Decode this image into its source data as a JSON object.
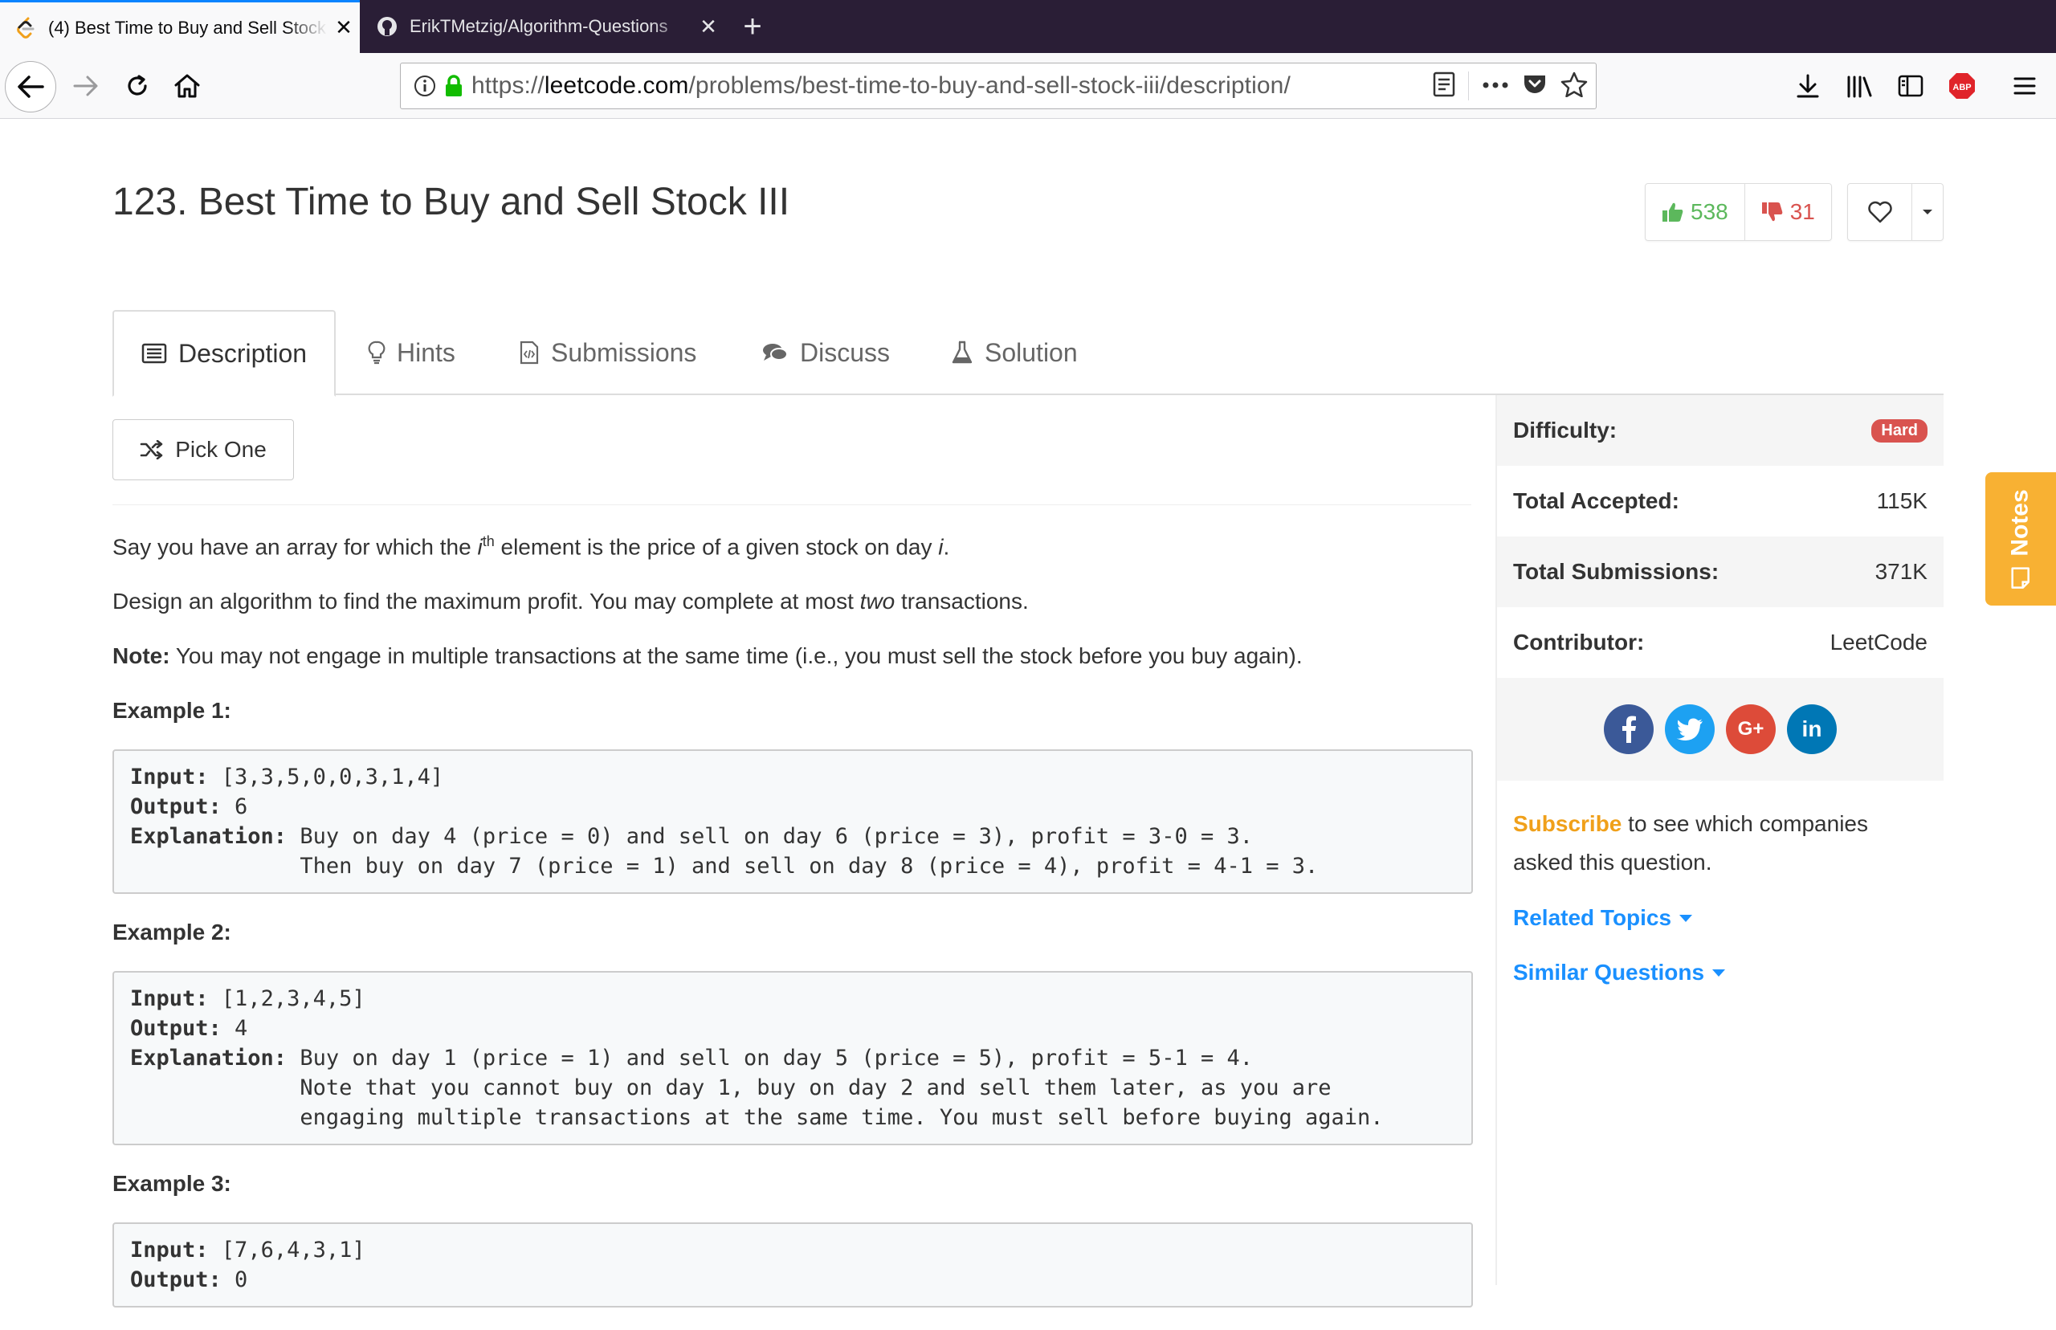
{
  "browser": {
    "tabs": [
      {
        "title": "(4) Best Time to Buy and Sell Stock",
        "active": true
      },
      {
        "title": "ErikTMetzig/Algorithm-Questions",
        "active": false
      }
    ],
    "url_scheme": "https://",
    "url_host": "leetcode.com",
    "url_path": "/problems/best-time-to-buy-and-sell-stock-iii/description/",
    "accent": "#0a84ff"
  },
  "problem": {
    "title": "123. Best Time to Buy and Sell Stock III",
    "likes": "538",
    "dislikes": "31"
  },
  "tabs": [
    "Description",
    "Hints",
    "Submissions",
    "Discuss",
    "Solution"
  ],
  "pick_one": "Pick One",
  "description": {
    "p1_a": "Say you have an array for which the ",
    "p1_i": "i",
    "p1_sup": "th",
    "p1_b": " element is the price of a given stock on day ",
    "p1_day": "i",
    "p1_end": ".",
    "p2_a": "Design an algorithm to find the maximum profit. You may complete at most ",
    "p2_em": "two",
    "p2_b": " transactions.",
    "note_label": "Note:",
    "note_text": " You may not engage in multiple transactions at the same time (i.e., you must sell the stock before you buy again).",
    "examples": [
      {
        "heading": "Example 1:",
        "input_label": "Input:",
        "input": " [3,3,5,0,0,3,1,4]",
        "output_label": "Output:",
        "output": " 6",
        "expl_label": "Explanation:",
        "expl_lines": [
          " Buy on day 4 (price = 0) and sell on day 6 (price = 3), profit = 3-0 = 3.",
          "             Then buy on day 7 (price = 1) and sell on day 8 (price = 4), profit = 4-1 = 3."
        ]
      },
      {
        "heading": "Example 2:",
        "input_label": "Input:",
        "input": " [1,2,3,4,5]",
        "output_label": "Output:",
        "output": " 4",
        "expl_label": "Explanation:",
        "expl_lines": [
          " Buy on day 1 (price = 1) and sell on day 5 (price = 5), profit = 5-1 = 4.",
          "             Note that you cannot buy on day 1, buy on day 2 and sell them later, as you are",
          "             engaging multiple transactions at the same time. You must sell before buying again."
        ]
      },
      {
        "heading": "Example 3:",
        "input_label": "Input:",
        "input": " [7,6,4,3,1]",
        "output_label": "Output:",
        "output": " 0"
      }
    ]
  },
  "sidebar": {
    "difficulty_label": "Difficulty:",
    "difficulty": "Hard",
    "accepted_label": "Total Accepted:",
    "accepted": "115K",
    "submissions_label": "Total Submissions:",
    "submissions": "371K",
    "contributor_label": "Contributor:",
    "contributor": "LeetCode",
    "social": [
      "f",
      "t",
      "G+",
      "in"
    ],
    "subscribe_link": "Subscribe",
    "subscribe_text": " to see which companies asked this question.",
    "related_topics": "Related Topics",
    "similar_questions": "Similar Questions"
  },
  "notes_label": "Notes",
  "colors": {
    "hard": "#d9534f",
    "like": "#5cb85c",
    "dislike": "#d9534f",
    "subscribe": "#f0a01a",
    "link": "#1a90ff",
    "notes_tab": "#f8b133"
  }
}
